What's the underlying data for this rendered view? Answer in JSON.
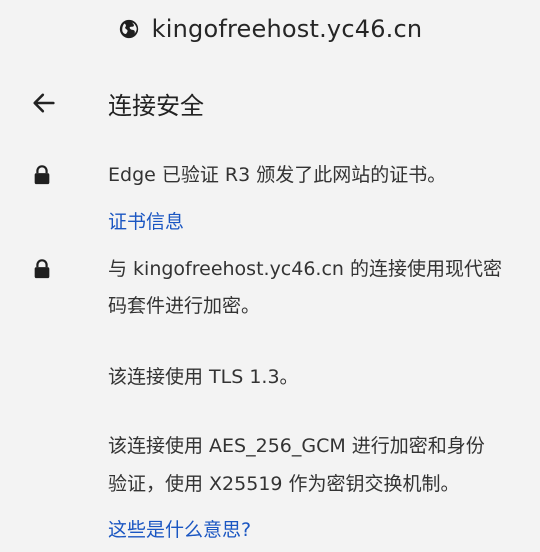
{
  "domain_bar": {
    "icon": "globe-icon",
    "domain": "kingofreehost.yc46.cn"
  },
  "header": {
    "back_icon": "arrow-left-icon",
    "title": "连接安全"
  },
  "certificate_section": {
    "icon": "lock-icon",
    "text": "Edge 已验证 R3 颁发了此网站的证书。",
    "link_label": "证书信息"
  },
  "connection_section": {
    "icon": "lock-icon",
    "line1": "与 kingofreehost.yc46.cn 的连接使用现代密",
    "line2": "码套件进行加密。",
    "tls_text": "该连接使用 TLS 1.3。",
    "cipher_line1": "该连接使用 AES_256_GCM 进行加密和身份",
    "cipher_line2": "验证，使用 X25519 作为密钥交换机制。",
    "help_link": "这些是什么意思?"
  },
  "colors": {
    "background": "#f3f3f3",
    "link": "#1a56c2",
    "text": "#333333"
  }
}
